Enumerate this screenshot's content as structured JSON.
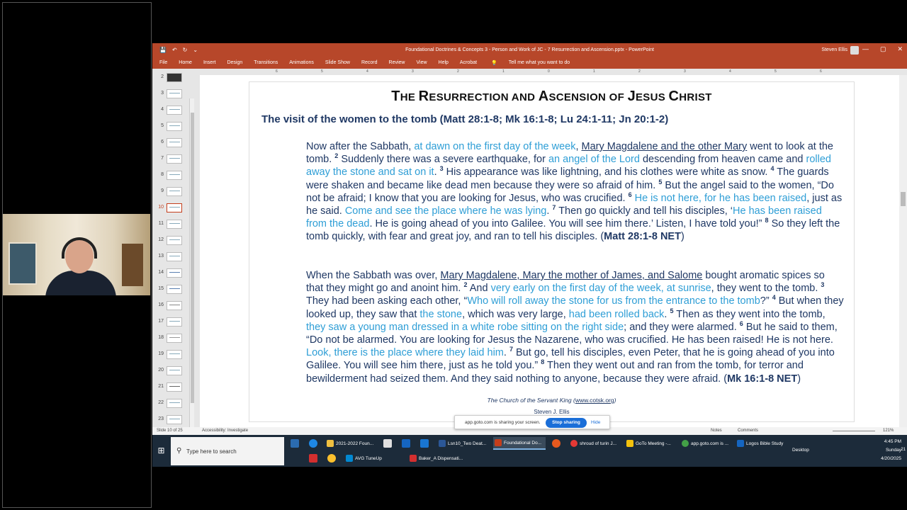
{
  "titlebar": {
    "document_title": "Foundational Doctrines & Concepts 3 - Person and Work of JC - 7 Resurrection and Ascension.pptx - PowerPoint",
    "user_name": "Steven Ellis",
    "minimize": "—",
    "restore": "▢",
    "close": "✕"
  },
  "menu": {
    "items": [
      "File",
      "Home",
      "Insert",
      "Design",
      "Transitions",
      "Animations",
      "Slide Show",
      "Record",
      "Review",
      "View",
      "Help",
      "Acrobat"
    ],
    "tell_me": "Tell me what you want to do"
  },
  "ruler": [
    "6",
    "5",
    "4",
    "3",
    "2",
    "1",
    "0",
    "1",
    "2",
    "3",
    "4",
    "5",
    "6"
  ],
  "thumbnails": [
    "2",
    "3",
    "4",
    "5",
    "6",
    "7",
    "8",
    "9",
    "10",
    "11",
    "12",
    "13",
    "14",
    "15",
    "16",
    "17",
    "18",
    "19",
    "20",
    "21",
    "22",
    "23"
  ],
  "slide": {
    "title_first": "T",
    "title_rest1": "HE ",
    "title_R": "R",
    "title_rest2": "ESURRECTION AND ",
    "title_A": "A",
    "title_rest3": "SCENSION OF ",
    "title_J": "J",
    "title_rest4": "ESUS ",
    "title_C": "C",
    "title_rest5": "HRIST",
    "subtitle": "The visit of the women to the tomb (Matt 28:1-8; Mk 16:1-8; Lu 24:1-11; Jn 20:1-2)",
    "p1": {
      "a": "Now after the Sabbath, ",
      "b": "at dawn on the first day of the week",
      "c": ", ",
      "d": "Mary Magdalene and the other Mary",
      "e": " went to look at the tomb. ",
      "v2": "2",
      "f": " Suddenly there was a severe earthquake, for ",
      "g": "an angel of the Lord",
      "h": " descending from heaven came and ",
      "i": "rolled away the stone and sat on it",
      "j": ". ",
      "v3": "3",
      "k": " His appearance was like lightning, and his clothes were white as snow. ",
      "v4": "4",
      "l": " The guards were shaken and became like dead men because they were so afraid of him. ",
      "v5": "5",
      "m": " But the angel said to the women, “Do not be afraid; I know that you are looking for Jesus, who was crucified. ",
      "v6": "6",
      "n": " He is not here, for he has been raised",
      "o": ", just as he said. ",
      "p": "Come and see the place where he was lying",
      "q": ". ",
      "v7": "7",
      "r": " Then go quickly and tell his disciples, ‘",
      "s": "He has been raised from the dead",
      "t": ". He is going ahead of you into Galilee. You will see him there.’ Listen, I have told you!” ",
      "v8": "8",
      "u": " So they left the tomb quickly, with fear and great joy, and ran to tell his disciples. (",
      "ref": "Matt 28:1-8 NET",
      "end": ")"
    },
    "p2": {
      "a": "When the Sabbath was over, ",
      "b": "Mary Magdalene, Mary the mother of James, and Salome",
      "c": " bought aromatic spices so that they might go and anoint him. ",
      "v2": "2",
      "d": " And ",
      "e": "very early on the first day of the week, at sunrise",
      "f": ", they went to the tomb. ",
      "v3": "3",
      "g": " They had been asking each other, “",
      "h": "Who will roll away the stone for us from the entrance to the tomb",
      "i": "?” ",
      "v4": "4",
      "j": " But when they looked up, they saw that ",
      "k": "the stone",
      "l": ", which was very large, ",
      "m": "had been rolled back",
      "n": ". ",
      "v5": "5",
      "o": " Then as they went into the tomb, ",
      "p": "they saw a young man dressed in a white robe sitting on the right side",
      "q": "; and they were alarmed. ",
      "v6": "6",
      "r": " But he said to them, “Do not be alarmed. You are looking for Jesus the Nazarene, who was crucified. He has been raised! He is not here. ",
      "s": "Look, there is the place where they laid him",
      "t": ". ",
      "v7": "7",
      "u": " But go, tell his disciples, even Peter, that he is going ahead of you into Galilee. You will see him there, just as he told you.” ",
      "v8": "8",
      "w": " Then they went out and ran from the tomb, for terror and bewilderment had seized them. And they said nothing to anyone, because they were afraid. (",
      "ref": "Mk 16:1-8 NET",
      "end": ")"
    },
    "footer_org": "The Church of the Servant King",
    "footer_url": "www.cotsk.org",
    "footer_author": "Steven J. Ellis"
  },
  "statusbar": {
    "slide_of": "Slide 10 of 25",
    "accessibility": "Accessibility: Investigate",
    "notes": "Notes",
    "comments": "Comments",
    "zoom": "121%"
  },
  "share_bar": {
    "text": "app.goto.com is sharing your screen.",
    "stop": "Stop sharing",
    "hide": "Hide"
  },
  "taskbar": {
    "search_placeholder": "Type here to search",
    "items": {
      "folder": "2021-2022 Foun...",
      "lsn10": "Lsn10_Two Deat...",
      "ppt": "Foundational Do...",
      "shroud": "shroud of turin J...",
      "goto": "GoTo Meeting -...",
      "appgoto": "app.goto.com is ...",
      "logos": "Logos Bible Study",
      "avg": "AVG TuneUp",
      "baker": "Baker_A Dispensati..."
    },
    "desktop": "Desktop",
    "time": "4:45 PM",
    "day": "Sunday",
    "date": "4/20/2025",
    "notif_count": "21"
  },
  "colors": {
    "ppt_accent": "#b7472a",
    "text_navy": "#1f3864",
    "highlight_blue": "#2e9ed6",
    "taskbar": "#1c2b3a"
  }
}
